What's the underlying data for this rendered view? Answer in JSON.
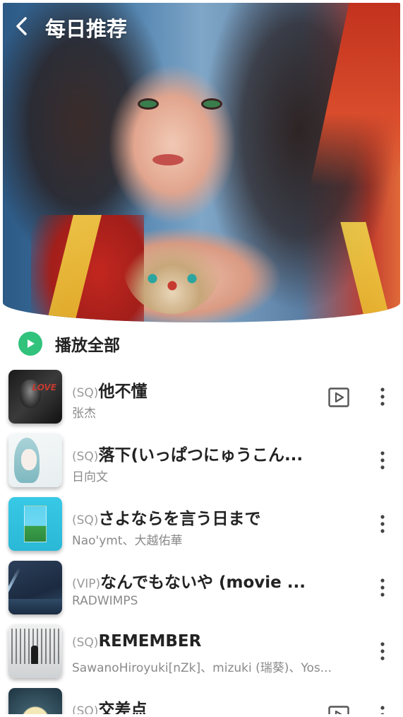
{
  "header": {
    "title": "每日推荐",
    "back_icon": "chevron-left-icon"
  },
  "play_all": {
    "label": "播放全部",
    "icon": "play-circle-icon",
    "accent": "#31c27c"
  },
  "songs": [
    {
      "quality": "(SQ)",
      "title": "他不懂",
      "artist": "张杰",
      "has_mv": true
    },
    {
      "quality": "(SQ)",
      "title": "落下(いっぱつにゅうこん...",
      "artist": "日向文",
      "has_mv": false
    },
    {
      "quality": "(SQ)",
      "title": "さよならを言う日まで",
      "artist": "Nao'ymt、大越佑華",
      "has_mv": false
    },
    {
      "quality": "(VIP)",
      "title": "なんでもないや (movie ...",
      "artist": "RADWIMPS",
      "has_mv": false
    },
    {
      "quality": "(SQ)",
      "title": "REMEMBER",
      "artist": "SawanoHiroyuki[nZk]、mizuki (瑞葵)、Yos...",
      "has_mv": false
    },
    {
      "quality": "(SQ)",
      "title": "交差点",
      "artist": "",
      "has_mv": true
    }
  ],
  "colors": {
    "title_text": "#222222",
    "quality_text": "#9a9a9a",
    "artist_text": "#8a8a8a"
  }
}
